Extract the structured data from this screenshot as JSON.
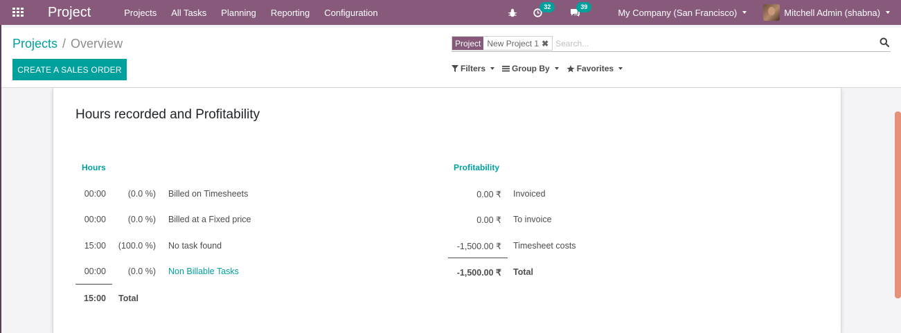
{
  "navbar": {
    "app_title": "Project",
    "menu": [
      "Projects",
      "All Tasks",
      "Planning",
      "Reporting",
      "Configuration"
    ],
    "activity_count": "32",
    "messages_count": "39",
    "company": "My Company (San Francisco)",
    "user": "Mitchell Admin (shabna)"
  },
  "breadcrumb": {
    "parent": "Projects",
    "separator": "/",
    "current": "Overview"
  },
  "toolbar": {
    "create_sales_order_label": "CREATE A SALES ORDER"
  },
  "search": {
    "facet_label": "Project",
    "facet_value": "New Project 1",
    "placeholder": "Search..."
  },
  "filters_bar": {
    "filters_label": "Filters",
    "group_by_label": "Group By",
    "favorites_label": "Favorites"
  },
  "overview": {
    "title": "Hours recorded and Profitability",
    "hours": {
      "header": "Hours",
      "rows": [
        {
          "hours": "00:00",
          "percent": "(0.0 %)",
          "label": "Billed on Timesheets"
        },
        {
          "hours": "00:00",
          "percent": "(0.0 %)",
          "label": "Billed at a Fixed price"
        },
        {
          "hours": "15:00",
          "percent": "(100.0 %)",
          "label": "No task found"
        },
        {
          "hours": "00:00",
          "percent": "(0.0 %)",
          "label": "Non Billable Tasks"
        }
      ],
      "total_hours": "15:00",
      "total_label": "Total"
    },
    "profitability": {
      "header": "Profitability",
      "rows": [
        {
          "amount": "0.00 ₹",
          "label": "Invoiced"
        },
        {
          "amount": "0.00 ₹",
          "label": "To invoice"
        },
        {
          "amount": "-1,500.00 ₹",
          "label": "Timesheet costs"
        }
      ],
      "total_amount": "-1,500.00 ₹",
      "total_label": "Total"
    }
  },
  "colors": {
    "brand": "#875a7b",
    "accent": "#00a09d",
    "badge": "#00a09d",
    "scrollbar": "#e8917a"
  }
}
